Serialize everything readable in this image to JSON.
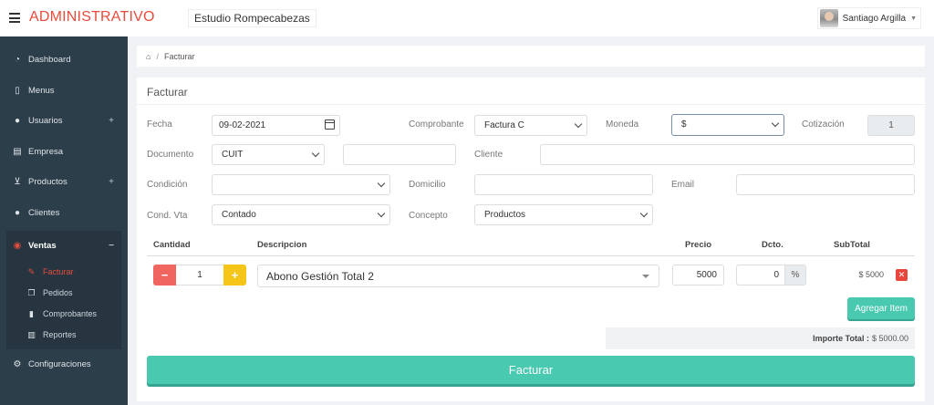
{
  "topbar": {
    "brand": "ADMINISTRATIVO",
    "company": "Estudio Rompecabezas",
    "user_name": "Santiago Argilla"
  },
  "sidebar": {
    "items": [
      {
        "label": "Dashboard",
        "icon": "dashboard-icon"
      },
      {
        "label": "Menus",
        "icon": "book-icon"
      },
      {
        "label": "Usuarios",
        "icon": "users-icon",
        "expand": "+"
      },
      {
        "label": "Empresa",
        "icon": "building-icon"
      },
      {
        "label": "Productos",
        "icon": "cart-icon",
        "expand": "+"
      },
      {
        "label": "Clientes",
        "icon": "users-icon"
      },
      {
        "label": "Ventas",
        "icon": "eye-icon",
        "expand": "−"
      },
      {
        "label": "Configuraciones",
        "icon": "cogs-icon"
      }
    ],
    "ventas_sub": [
      {
        "label": "Facturar",
        "icon": "edit-icon"
      },
      {
        "label": "Pedidos",
        "icon": "copy-icon"
      },
      {
        "label": "Comprobantes",
        "icon": "file-icon"
      },
      {
        "label": "Reportes",
        "icon": "bar-chart-icon"
      }
    ]
  },
  "breadcrumb": {
    "current": "Facturar",
    "separator": "/"
  },
  "form": {
    "title": "Facturar",
    "fecha_label": "Fecha",
    "fecha_value": "09-02-2021",
    "comprobante_label": "Comprobante",
    "comprobante_value": "Factura C",
    "moneda_label": "Moneda",
    "moneda_value": "$",
    "cotizacion_label": "Cotización",
    "cotizacion_value": "1",
    "documento_label": "Documento",
    "documento_value": "CUIT",
    "documento_number": "",
    "cliente_label": "Cliente",
    "cliente_value": "",
    "condicion_label": "Condición",
    "condicion_value": "",
    "domicilio_label": "Domicilio",
    "domicilio_value": "",
    "email_label": "Email",
    "email_value": "",
    "condvta_label": "Cond. Vta",
    "condvta_value": "Contado",
    "concepto_label": "Concepto",
    "concepto_value": "Productos"
  },
  "table": {
    "headers": {
      "cantidad": "Cantidad",
      "descripcion": "Descripcion",
      "precio": "Precio",
      "dcto": "Dcto.",
      "subtotal": "SubTotal"
    },
    "row": {
      "cantidad": "1",
      "descripcion": "Abono Gestión Total 2",
      "precio": "5000",
      "dcto": "0",
      "dcto_unit": "%",
      "subtotal": "$ 5000"
    }
  },
  "actions": {
    "agregar_label": "Agregar Item",
    "importe_label": "Importe Total :",
    "importe_value": "$ 5000.00",
    "facturar_label": "Facturar"
  },
  "colors": {
    "brand": "#e74c3c",
    "sidebar_bg": "#2d3e4b",
    "accent_teal": "#48c9b0",
    "minus_red": "#f06560",
    "plus_yellow": "#f5c518"
  }
}
